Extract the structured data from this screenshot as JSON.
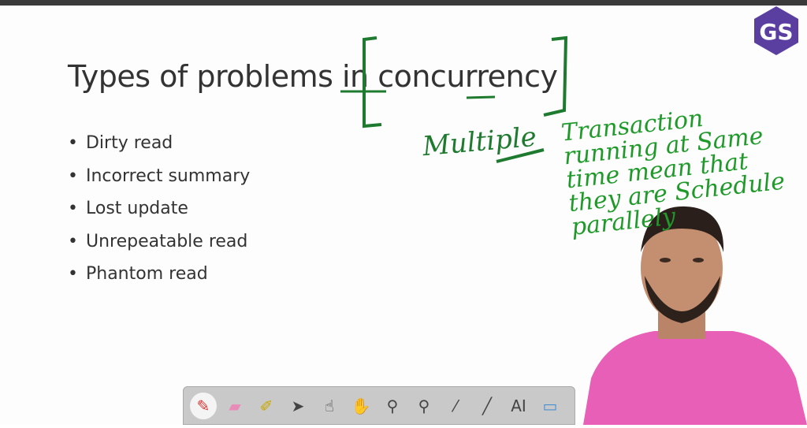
{
  "slide": {
    "title": "Types of problems in concurrency",
    "bullets": [
      "Dirty read",
      "Incorrect summary",
      "Lost update",
      "Unrepeatable read",
      "Phantom read"
    ]
  },
  "annotations": {
    "word": "Multiple",
    "note": "Transaction\nrunning at Same\ntime mean that\nthey are Schedule\nparallely",
    "color": "#1f9a2a"
  },
  "logo": {
    "text": "GS",
    "color": "#5b3fa0"
  },
  "toolbar": {
    "tools": [
      {
        "icon": "pen-icon",
        "glyph": "✎"
      },
      {
        "icon": "eraser-icon",
        "glyph": "▰"
      },
      {
        "icon": "highlighter-icon",
        "glyph": "✐"
      },
      {
        "icon": "pointer-arrow-icon",
        "glyph": "➤"
      },
      {
        "icon": "pointing-hand-icon",
        "glyph": "☝"
      },
      {
        "icon": "pan-hand-icon",
        "glyph": "✋"
      },
      {
        "icon": "zoom-in-icon",
        "glyph": "⚲"
      },
      {
        "icon": "zoom-out-icon",
        "glyph": "⚲"
      },
      {
        "icon": "laser-pointer-icon",
        "glyph": "⁄"
      },
      {
        "icon": "line-icon",
        "glyph": "╱"
      },
      {
        "icon": "text-tool-icon",
        "glyph": "AI"
      },
      {
        "icon": "screen-icon",
        "glyph": "▭"
      }
    ]
  }
}
